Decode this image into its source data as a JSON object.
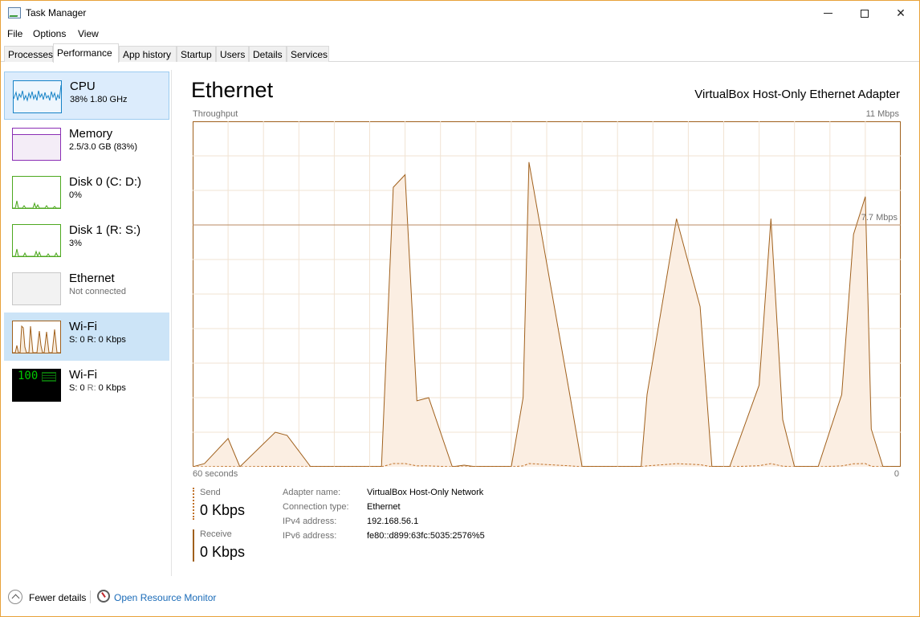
{
  "window": {
    "title": "Task Manager"
  },
  "menu": {
    "file": "File",
    "options": "Options",
    "view": "View"
  },
  "tabs": [
    {
      "label": "Processes",
      "active": false
    },
    {
      "label": "Performance",
      "active": true
    },
    {
      "label": "App history",
      "active": false
    },
    {
      "label": "Startup",
      "active": false
    },
    {
      "label": "Users",
      "active": false
    },
    {
      "label": "Details",
      "active": false
    },
    {
      "label": "Services",
      "active": false
    }
  ],
  "sidebar": {
    "items": [
      {
        "name": "CPU",
        "sub": "38%  1.80 GHz",
        "color": "#1783c7"
      },
      {
        "name": "Memory",
        "sub": "2.5/3.0 GB (83%)",
        "color": "#8a2eb4"
      },
      {
        "name": "Disk 0 (C: D:)",
        "sub": "0%",
        "color": "#4da81f"
      },
      {
        "name": "Disk 1 (R: S:)",
        "sub": "3%",
        "color": "#4da81f"
      },
      {
        "name": "Ethernet",
        "sub": "Not connected",
        "color": "#c0c0c0"
      },
      {
        "name": "Wi-Fi",
        "sub": "S: 0  R: 0 Kbps",
        "color": "#a0601c"
      },
      {
        "name": "Wi-Fi",
        "sub_prefix": "S: 0 ",
        "sub_mid": "R:",
        "sub_suffix": " 0 Kbps",
        "overlay": "100",
        "color": "#00c800"
      }
    ]
  },
  "main": {
    "title": "Ethernet",
    "adapter": "VirtualBox Host-Only Ethernet Adapter",
    "throughput_label": "Throughput",
    "max_label": "11 Mbps",
    "marker_label": "7.7 Mbps",
    "time_label": "60 seconds",
    "zero_label": "0",
    "send_label": "Send",
    "send_value": "0 Kbps",
    "recv_label": "Receive",
    "recv_value": "0 Kbps",
    "properties": [
      {
        "key": "Adapter name:",
        "value": "VirtualBox Host-Only Network"
      },
      {
        "key": "Connection type:",
        "value": "Ethernet"
      },
      {
        "key": "IPv4 address:",
        "value": "192.168.56.1"
      },
      {
        "key": "IPv6 address:",
        "value": "fe80::d899:63fc:5035:2576%5"
      }
    ]
  },
  "footer": {
    "fewer": "Fewer details",
    "resmon": "Open Resource Monitor"
  },
  "chart_data": {
    "type": "area",
    "ylim": [
      0,
      11
    ],
    "xlim": [
      60,
      0
    ],
    "marker": 7.7,
    "series": [
      {
        "x": [
          60,
          59,
          57,
          56,
          53,
          52,
          50,
          44,
          43,
          42,
          41,
          40,
          38,
          37,
          36,
          33,
          32,
          31.5,
          28,
          27,
          25,
          22,
          21.5,
          19,
          17,
          16,
          15,
          14.5,
          12,
          11,
          10,
          9,
          8.5,
          7,
          5,
          4,
          3,
          2.5,
          1.5,
          0.8
        ],
        "values": [
          0,
          0.1,
          0.9,
          0,
          1.1,
          1.0,
          0,
          0,
          8.9,
          9.3,
          2.1,
          2.2,
          0,
          0.05,
          0,
          0,
          2.2,
          9.7,
          2.2,
          0,
          0,
          0,
          2.3,
          7.9,
          5.1,
          0,
          0,
          0,
          2.6,
          7.9,
          1.5,
          0,
          0,
          0,
          2.3,
          7.4,
          8.6,
          1.2,
          0,
          0
        ]
      }
    ]
  }
}
